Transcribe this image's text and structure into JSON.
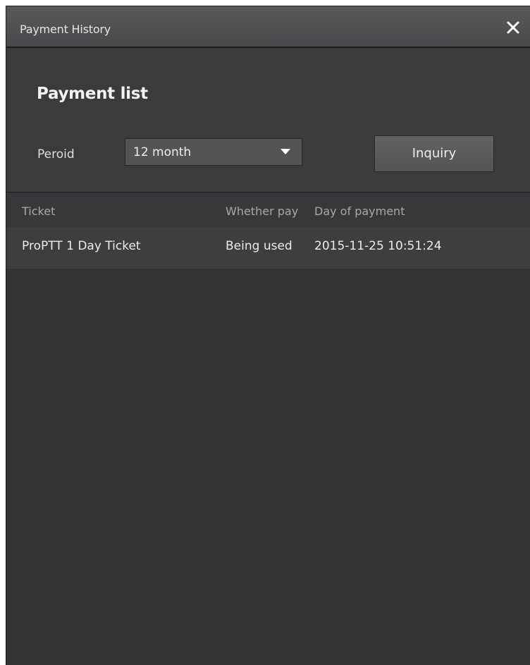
{
  "window": {
    "title": "Payment History"
  },
  "panel": {
    "heading": "Payment list",
    "period_label": "Peroid",
    "period_selected": "12 month",
    "inquiry_label": "Inquiry"
  },
  "table": {
    "columns": [
      "Ticket",
      "Whether pay",
      "Day of payment"
    ],
    "rows": [
      {
        "ticket": "ProPTT 1 Day Ticket",
        "status": "Being used",
        "date": "2015-11-25 10:51:24"
      }
    ]
  },
  "icons": {
    "close": "close-icon",
    "dropdown": "chevron-down-icon"
  },
  "colors": {
    "window_bg": "#36363a",
    "titlebar": "#4f4f52",
    "text": "#ececec"
  }
}
